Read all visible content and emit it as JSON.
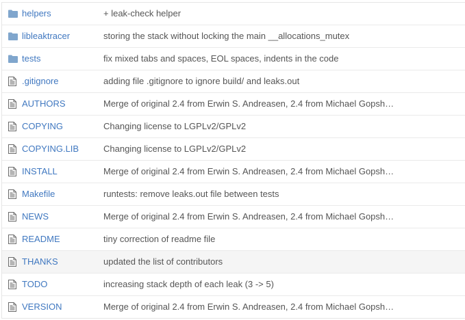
{
  "colors": {
    "link": "#4078c0",
    "message": "#555555",
    "folder_icon": "#80a6cd",
    "file_icon": "#6a6a6a",
    "row_border": "#eaeaea",
    "hover_row": "#f5f5f5"
  },
  "files": [
    {
      "name": "helpers",
      "type": "folder",
      "icon": "folder-icon",
      "message": "+ leak-check helper"
    },
    {
      "name": "libleaktracer",
      "type": "folder",
      "icon": "folder-icon",
      "message": "storing the stack without locking the main __allocations_mutex"
    },
    {
      "name": "tests",
      "type": "folder",
      "icon": "folder-icon",
      "message": "fix mixed tabs and spaces, EOL spaces, indents in the code"
    },
    {
      "name": ".gitignore",
      "type": "file",
      "icon": "file-text-icon",
      "message": "adding file .gitignore to ignore build/ and leaks.out"
    },
    {
      "name": "AUTHORS",
      "type": "file",
      "icon": "file-text-icon",
      "message": "Merge of original 2.4 from Erwin S. Andreasen, 2.4 from Michael Gopsh…"
    },
    {
      "name": "COPYING",
      "type": "file",
      "icon": "file-text-icon",
      "message": "Changing license to LGPLv2/GPLv2"
    },
    {
      "name": "COPYING.LIB",
      "type": "file",
      "icon": "file-text-icon",
      "message": "Changing license to LGPLv2/GPLv2"
    },
    {
      "name": "INSTALL",
      "type": "file",
      "icon": "file-text-icon",
      "message": "Merge of original 2.4 from Erwin S. Andreasen, 2.4 from Michael Gopsh…"
    },
    {
      "name": "Makefile",
      "type": "file",
      "icon": "file-text-icon",
      "message": "runtests: remove leaks.out file between tests"
    },
    {
      "name": "NEWS",
      "type": "file",
      "icon": "file-text-icon",
      "message": "Merge of original 2.4 from Erwin S. Andreasen, 2.4 from Michael Gopsh…"
    },
    {
      "name": "README",
      "type": "file",
      "icon": "file-text-icon",
      "message": "tiny correction of readme file"
    },
    {
      "name": "THANKS",
      "type": "file",
      "icon": "file-text-icon",
      "message": "updated the list of contributors",
      "hovered": true
    },
    {
      "name": "TODO",
      "type": "file",
      "icon": "file-text-icon",
      "message": "increasing stack depth of each leak (3 -> 5)"
    },
    {
      "name": "VERSION",
      "type": "file",
      "icon": "file-text-icon",
      "message": "Merge of original 2.4 from Erwin S. Andreasen, 2.4 from Michael Gopsh…"
    }
  ]
}
